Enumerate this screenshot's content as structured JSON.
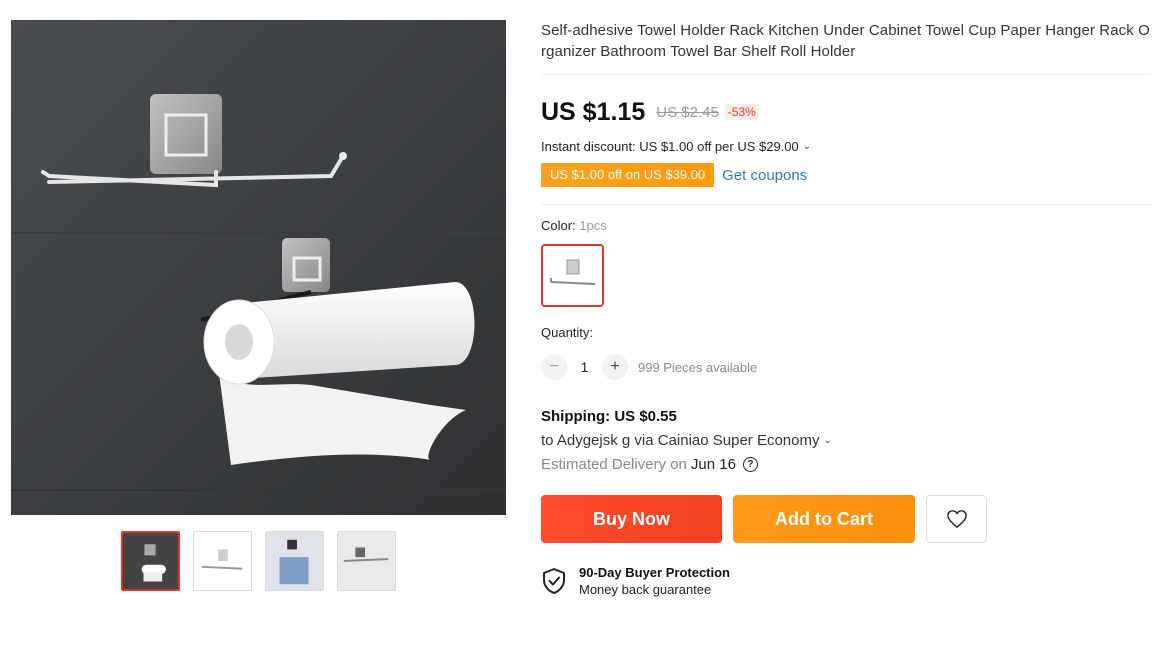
{
  "product": {
    "title": "Self-adhesive Towel Holder Rack Kitchen Under Cabinet Towel Cup Paper Hanger Rack Organizer Bathroom Towel Bar Shelf Roll Holder",
    "price": "US $1.15",
    "original_price": "US $2.45",
    "discount": "-53%"
  },
  "promo": {
    "instant_discount": "Instant discount: US $1.00 off per US $29.00",
    "coupon_label": "US $1.00 off on US $39.00",
    "get_coupons": "Get coupons"
  },
  "color": {
    "label": "Color:",
    "value": "1pcs"
  },
  "quantity": {
    "label": "Quantity:",
    "minus": "−",
    "plus": "+",
    "value": "1",
    "available": "999 Pieces available"
  },
  "shipping": {
    "title": "Shipping: US $0.55",
    "to": "to Adygejsk g via Cainiao Super Economy",
    "eta_label": "Estimated Delivery on",
    "eta_date": "Jun 16",
    "help": "?"
  },
  "actions": {
    "buy_now": "Buy Now",
    "add_to_cart": "Add to Cart"
  },
  "protection": {
    "title": "90-Day Buyer Protection",
    "subtitle": "Money back guarantee"
  },
  "colors": {
    "accent_red": "#e43225",
    "buy_button": "#f0411f",
    "cart_button": "#fb8f0a",
    "coupon": "#fb9a0d",
    "link": "#2b7fa8"
  },
  "icons": {
    "wishlist": "heart-icon",
    "protection": "shield-check-icon",
    "help": "question-circle-icon",
    "dropdown": "chevron-down-icon"
  }
}
